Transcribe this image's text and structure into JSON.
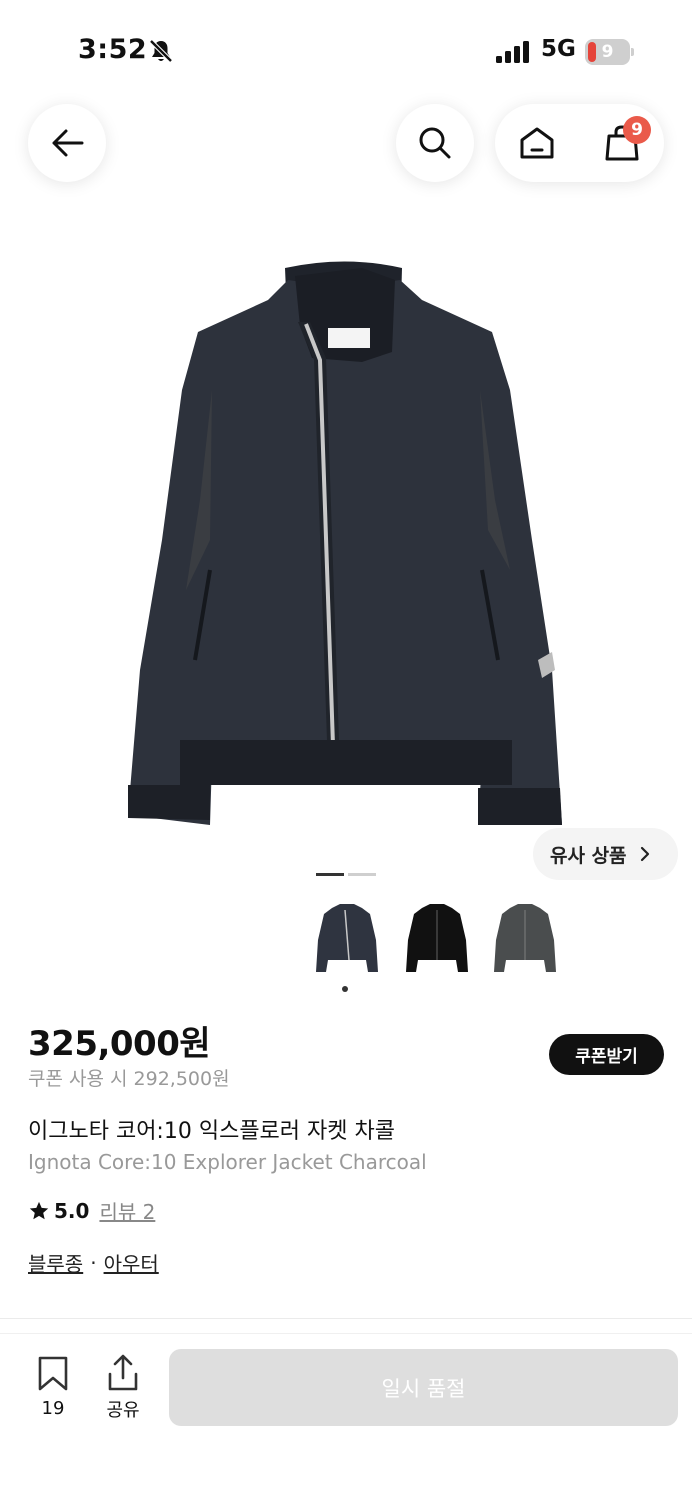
{
  "status_bar": {
    "time": "3:52",
    "network": "5G",
    "battery": "9",
    "icons": [
      "bell-slash-icon",
      "signal-icon",
      "battery-icon"
    ]
  },
  "header": {
    "icons": [
      "back-arrow-icon",
      "search-icon",
      "home-icon",
      "shopping-bag-icon"
    ],
    "cart_count": "9"
  },
  "gallery": {
    "image_alt": "Ignota Core:10 Explorer Jacket Charcoal",
    "similar_label": "유사 상품",
    "current_page": 1,
    "total_pages": 2,
    "thumbnails": [
      {
        "color": "#2f3440"
      },
      {
        "color": "#111111"
      },
      {
        "color": "#4a4d4e"
      }
    ],
    "selected_thumbnail": 1
  },
  "product": {
    "price": "325,000원",
    "coupon_price": "쿠폰 사용 시 292,500원",
    "coupon_button": "쿠폰받기",
    "name_ko": "이그노타 코어:10 익스플로러 자켓 차콜",
    "name_en": "Ignota Core:10 Explorer Jacket Charcoal",
    "rating": "5.0",
    "review_link": "리뷰 2",
    "brand": "블루종",
    "separator": "·",
    "category": "아우터"
  },
  "bottom_bar": {
    "bookmark_count": "19",
    "share_label": "공유",
    "soldout_label": "일시 품절"
  },
  "colors": {
    "badge": "#ea5a4a",
    "primary_dark": "#111111",
    "disabled": "#dedede"
  }
}
